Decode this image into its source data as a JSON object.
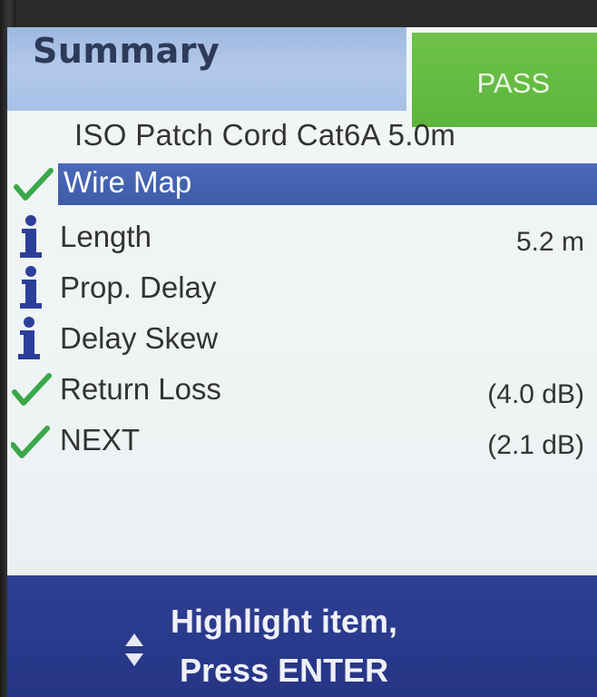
{
  "header": {
    "title": "Summary",
    "result": "PASS",
    "colors": {
      "title_bg": "#a6c0e6",
      "pass_bg": "#5db53c"
    }
  },
  "cable": "ISO Patch Cord Cat6A 5.0m",
  "tests": [
    {
      "label": "Wire Map",
      "value": "",
      "icon": "check-icon",
      "selected": true
    },
    {
      "label": "Length",
      "value": "5.2 m",
      "icon": "info-icon",
      "selected": false
    },
    {
      "label": "Prop. Delay",
      "value": "",
      "icon": "info-icon",
      "selected": false
    },
    {
      "label": "Delay Skew",
      "value": "",
      "icon": "info-icon",
      "selected": false
    },
    {
      "label": "Return Loss",
      "value": "(4.0 dB)",
      "icon": "check-icon",
      "selected": false
    },
    {
      "label": "NEXT",
      "value": "(2.1 dB)",
      "icon": "check-icon",
      "selected": false
    }
  ],
  "footer": {
    "line1": "Highlight item,",
    "line2": "Press ENTER",
    "icon": "up-down-arrows-icon"
  }
}
